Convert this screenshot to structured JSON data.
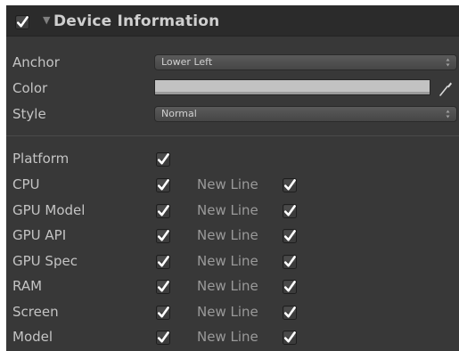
{
  "header": {
    "enabled": true,
    "title": "Device Information",
    "foldout_icon": "triangle-down-icon"
  },
  "fields": {
    "anchor": {
      "label": "Anchor",
      "value": "Lower Left"
    },
    "color": {
      "label": "Color",
      "value": "#c2c2c2"
    },
    "style": {
      "label": "Style",
      "value": "Normal"
    }
  },
  "options": {
    "new_line_label": "New Line",
    "rows": [
      {
        "label": "Platform",
        "checked": true,
        "new_line": null
      },
      {
        "label": "CPU",
        "checked": true,
        "new_line": true
      },
      {
        "label": "GPU Model",
        "checked": true,
        "new_line": true
      },
      {
        "label": "GPU API",
        "checked": true,
        "new_line": true
      },
      {
        "label": "GPU Spec",
        "checked": true,
        "new_line": true
      },
      {
        "label": "RAM",
        "checked": true,
        "new_line": true
      },
      {
        "label": "Screen",
        "checked": true,
        "new_line": true
      },
      {
        "label": "Model",
        "checked": true,
        "new_line": true
      }
    ]
  },
  "colors": {
    "panel_bg": "#383838",
    "header_bg": "#2b2b2b",
    "label_text": "#c4c4c4",
    "check_mark": "#ffffff"
  }
}
